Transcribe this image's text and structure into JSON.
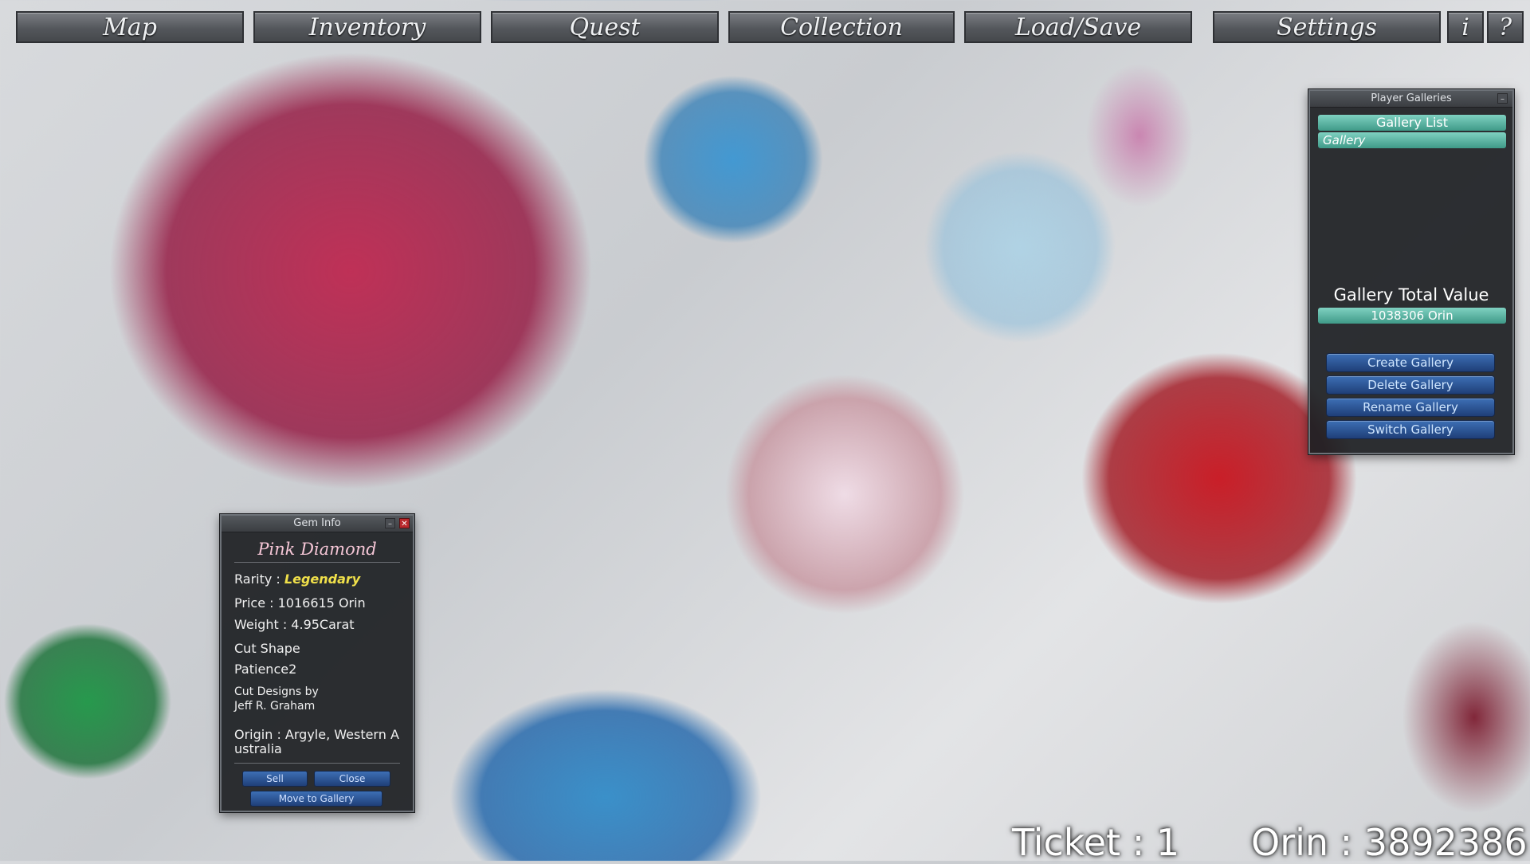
{
  "nav": {
    "map": "Map",
    "inventory": "Inventory",
    "quest": "Quest",
    "collection": "Collection",
    "loadsave": "Load/Save",
    "settings": "Settings",
    "info": "i",
    "help": "?"
  },
  "galleries": {
    "title": "Player Galleries",
    "list_label": "Gallery List",
    "items": [
      "Gallery"
    ],
    "total_label": "Gallery Total Value",
    "total_value": "1038306 Orin",
    "buttons": {
      "create": "Create Gallery",
      "delete": "Delete Gallery",
      "rename": "Rename Gallery",
      "switch": "Switch Gallery"
    }
  },
  "gem": {
    "title": "Gem Info",
    "name": "Pink Diamond",
    "rarity_label": "Rarity :",
    "rarity_value": "Legendary",
    "price": "Price : 1016615 Orin",
    "weight": "Weight : 4.95Carat",
    "cut_shape_label": "Cut Shape",
    "cut_shape_value": "Patience2",
    "cut_designs_line1": "Cut Designs by",
    "cut_designs_line2": "Jeff R. Graham",
    "origin_line1": "Origin : Argyle, Western A",
    "origin_line2": "ustralia",
    "sell": "Sell",
    "close": "Close",
    "move": "Move to Gallery",
    "colors": {
      "rarity": "#f0e04a",
      "name": "#f5c6d6"
    }
  },
  "hud": {
    "ticket": "Ticket : 1",
    "orin": "Orin : 3892386"
  }
}
